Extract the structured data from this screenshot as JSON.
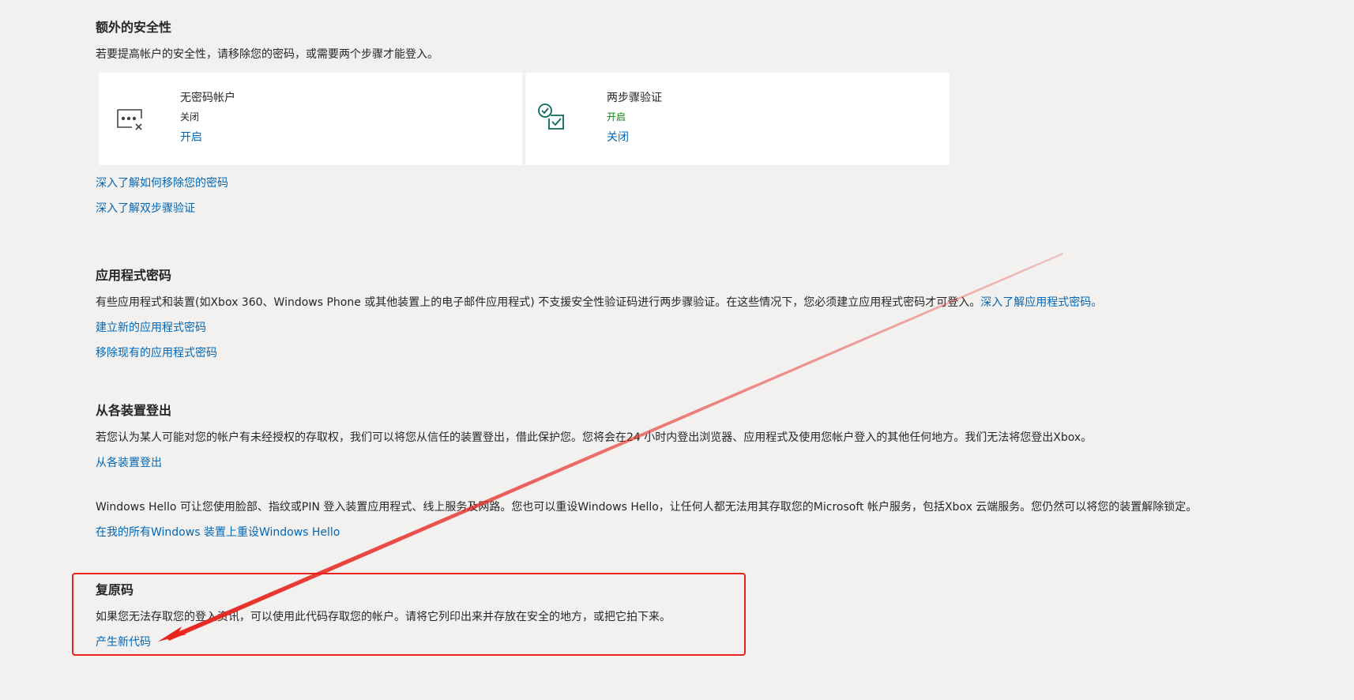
{
  "extra_security": {
    "title": "额外的安全性",
    "description": "若要提高帐户的安全性，请移除您的密码，或需要两个步骤才能登入。",
    "cards": [
      {
        "icon": "passwordless-icon",
        "title": "无密码帐户",
        "status": "关闭",
        "status_color": "#262626",
        "action": "开启"
      },
      {
        "icon": "two-step-verification-icon",
        "title": "两步骤验证",
        "status": "开启",
        "status_color": "#107c10",
        "action": "关闭"
      }
    ],
    "links": [
      "深入了解如何移除您的密码",
      "深入了解双步骤验证"
    ]
  },
  "app_passwords": {
    "title": "应用程式密码",
    "description": "有些应用程式和装置(如Xbox 360、Windows Phone 或其他装置上的电子邮件应用程式) 不支援安全性验证码进行两步骤验证。在这些情况下，您必须建立应用程式密码才可登入。",
    "inline_link": "深入了解应用程式密码。",
    "links": [
      "建立新的应用程式密码",
      "移除现有的应用程式密码"
    ]
  },
  "sign_out": {
    "title": "从各装置登出",
    "description": "若您认为某人可能对您的帐户有未经授权的存取权，我们可以将您从信任的装置登出，借此保护您。您将会在24 小时内登出浏览器、应用程式及使用您帐户登入的其他任何地方。我们无法将您登出Xbox。",
    "link": "从各装置登出"
  },
  "windows_hello": {
    "description": "Windows Hello 可让您使用脸部、指纹或PIN 登入装置应用程式、线上服务及网路。您也可以重设Windows Hello，让任何人都无法用其存取您的Microsoft 帐户服务，包括Xbox 云端服务。您仍然可以将您的装置解除锁定。",
    "link": "在我的所有Windows 装置上重设Windows Hello"
  },
  "recovery_code": {
    "title": "复原码",
    "description": "如果您无法存取您的登入资讯，可以使用此代码存取您的帐户。请将它列印出来并存放在安全的地方，或把它拍下来。",
    "link": "产生新代码"
  },
  "colors": {
    "link": "#0067b8",
    "annotation": "#e8231d",
    "background": "#f2f1f0",
    "icon_teal": "#0b6a5e"
  }
}
